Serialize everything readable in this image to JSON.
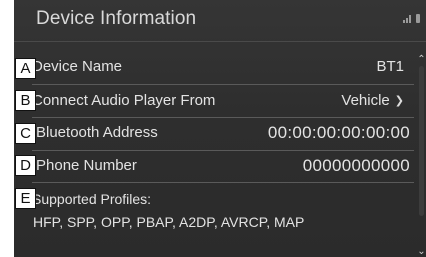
{
  "header": {
    "title": "Device Information"
  },
  "callouts": [
    "A",
    "B",
    "C",
    "D",
    "E"
  ],
  "rows": [
    {
      "label": "Device Name",
      "value": "BT1"
    },
    {
      "label": "Connect Audio Player From",
      "value": "Vehicle"
    },
    {
      "label": "Bluetooth Address",
      "value": "00:00:00:00:00:00"
    },
    {
      "label": "Phone Number",
      "value": "00000000000"
    }
  ],
  "profiles": {
    "label": "Supported Profiles:",
    "value": "HFP, SPP, OPP, PBAP, A2DP, AVRCP, MAP"
  },
  "icons": {
    "dropdown": "chevron-down-icon",
    "status": [
      "signal-icon",
      "battery-icon"
    ],
    "scroll": [
      "scroll-up-icon",
      "scroll-down-icon"
    ]
  },
  "colors": {
    "background": "#2e2e2e",
    "text": "#e3e3e3",
    "divider": "#5a5a5a"
  }
}
